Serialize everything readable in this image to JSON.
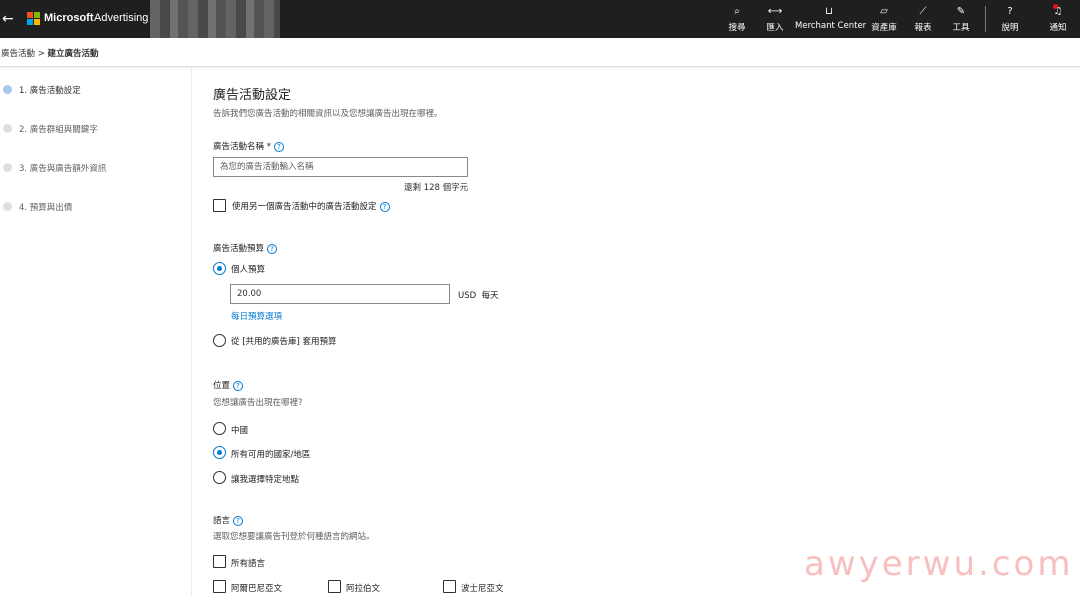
{
  "topbar": {
    "back_icon": "arrow-left-icon",
    "brand_name": "Microsoft",
    "brand_product": "Advertising",
    "nav": [
      {
        "label": "搜尋",
        "icon": "search-icon",
        "glyph": "⌕"
      },
      {
        "label": "匯入",
        "icon": "import-arrows-icon",
        "glyph": "⟷"
      },
      {
        "label": "Merchant Center",
        "icon": "cart-icon",
        "glyph": "🛒"
      },
      {
        "label": "資產庫",
        "icon": "asset-library-icon",
        "glyph": "▱"
      },
      {
        "label": "報表",
        "icon": "report-chart-icon",
        "glyph": "⟋"
      },
      {
        "label": "工具",
        "icon": "wrench-icon",
        "glyph": "✎"
      },
      {
        "label": "說明",
        "icon": "help-question-icon",
        "glyph": "?"
      },
      {
        "label": "通知",
        "icon": "bell-icon",
        "glyph": "🔔"
      }
    ]
  },
  "breadcrumb": {
    "parent": "廣告活動",
    "separator": ">",
    "current": "建立廣告活動"
  },
  "steps": [
    {
      "label": "1. 廣告活動設定",
      "active": true
    },
    {
      "label": "2. 廣告群組與關鍵字",
      "active": false
    },
    {
      "label": "3. 廣告與廣告額外資訊",
      "active": false
    },
    {
      "label": "4. 預算與出價",
      "active": false
    }
  ],
  "form": {
    "title": "廣告活動設定",
    "subtitle": "告訴我們您廣告活動的相關資訊以及您想讓廣告出現在哪裡。",
    "name": {
      "label": "廣告活動名稱 *",
      "placeholder": "為您的廣告活動輸入名稱",
      "counter": "還剩 128 個字元"
    },
    "copy_settings": {
      "label": "使用另一個廣告活動中的廣告活動設定",
      "checked": false
    },
    "budget": {
      "label": "廣告活動預算",
      "individual_label": "個人預算",
      "amount": "20.00",
      "currency": "USD",
      "period": "每天",
      "options_link": "每日預算選項",
      "shared_label": "從 [共用的廣告庫] 套用預算"
    },
    "location": {
      "label": "位置",
      "question": "您想讓廣告出現在哪裡?",
      "options": [
        {
          "label": "中國",
          "selected": false
        },
        {
          "label": "所有可用的國家/地區",
          "selected": true
        },
        {
          "label": "讓我選擇特定地點",
          "selected": false
        }
      ]
    },
    "language": {
      "label": "語言",
      "question": "選取您想要讓廣告刊登於何種語言的網站。",
      "all_label": "所有語言",
      "options": [
        "阿爾巴尼亞文",
        "阿拉伯文",
        "波士尼亞文"
      ]
    }
  },
  "watermark": "awyerwu.com"
}
